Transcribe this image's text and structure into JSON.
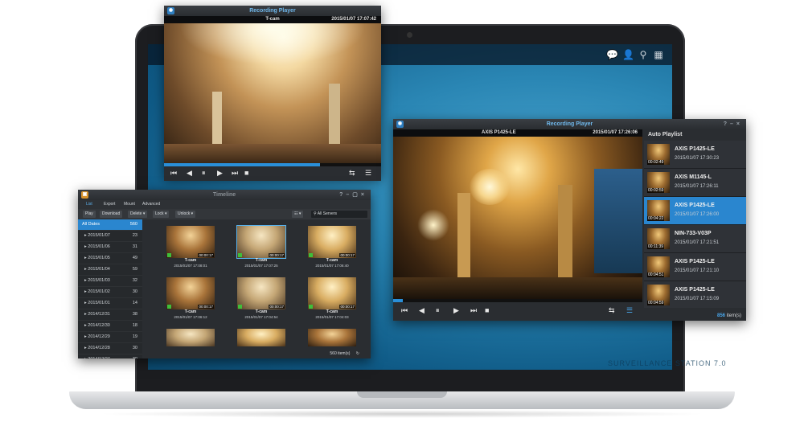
{
  "colors": {
    "accent": "#2a86cf",
    "desktop_blue": "#2a86b4",
    "window_bg": "#2a2d31"
  },
  "desktop": {
    "icons": [
      "chat-icon",
      "user-icon",
      "search-icon",
      "grid-icon"
    ],
    "watermark": "SURVEILLANCE STATION 7.0"
  },
  "player_small": {
    "title": "Recording Player",
    "camera": "T-cam",
    "timestamp": "2015/01/07 17:07:42",
    "progress": 0.72
  },
  "player_large": {
    "title": "Recording Player",
    "camera": "AXIS P1425-LE",
    "timestamp": "2015/01/07 17:26:06",
    "progress": 0.04,
    "playlist_title": "Auto Playlist",
    "items": [
      {
        "name": "AXIS P1425-LE",
        "time": "2015/01/07 17:30:23",
        "duration": "00:02:49",
        "selected": false
      },
      {
        "name": "AXIS M1145-L",
        "time": "2015/01/07 17:26:11",
        "duration": "00:02:59",
        "selected": false
      },
      {
        "name": "AXIS P1425-LE",
        "time": "2015/01/07 17:26:00",
        "duration": "00:04:22",
        "selected": true
      },
      {
        "name": "NIN-733-V03P",
        "time": "2015/01/07 17:21:51",
        "duration": "00:11:39",
        "selected": false
      },
      {
        "name": "AXIS P1425-LE",
        "time": "2015/01/07 17:21:10",
        "duration": "00:04:51",
        "selected": false
      },
      {
        "name": "AXIS P1425-LE",
        "time": "2015/01/07 17:15:09",
        "duration": "00:04:59",
        "selected": false
      }
    ],
    "count_value": "856",
    "count_label": " item(s)"
  },
  "timeline": {
    "title": "Timeline",
    "tabs": [
      "List",
      "Export",
      "Mount",
      "Advanced"
    ],
    "buttons": [
      "Play",
      "Download",
      "Delete ▾",
      "Lock ▾",
      "Unlock ▾"
    ],
    "search_placeholder": "All Servers",
    "dates": [
      {
        "label": "All Dates",
        "count": "560"
      },
      {
        "label": "2015/01/07",
        "count": "23"
      },
      {
        "label": "2015/01/06",
        "count": "31"
      },
      {
        "label": "2015/01/05",
        "count": "49"
      },
      {
        "label": "2015/01/04",
        "count": "59"
      },
      {
        "label": "2015/01/03",
        "count": "32"
      },
      {
        "label": "2015/01/02",
        "count": "30"
      },
      {
        "label": "2015/01/01",
        "count": "14"
      },
      {
        "label": "2014/12/31",
        "count": "38"
      },
      {
        "label": "2014/12/30",
        "count": "18"
      },
      {
        "label": "2014/12/29",
        "count": "19"
      },
      {
        "label": "2014/12/28",
        "count": "30"
      },
      {
        "label": "2014/12/27",
        "count": "30"
      }
    ],
    "recordings": [
      {
        "camera": "T-cam",
        "timestamp": "2015/01/07 17:08:01",
        "duration": "00:00:17",
        "selected": false
      },
      {
        "camera": "T-cam",
        "timestamp": "2015/01/07 17:07:25",
        "duration": "00:00:17",
        "selected": true
      },
      {
        "camera": "T-cam",
        "timestamp": "2015/01/07 17:06:40",
        "duration": "00:00:17",
        "selected": false
      },
      {
        "camera": "T-cam",
        "timestamp": "2015/01/07 17:06:12",
        "duration": "00:00:17",
        "selected": false
      },
      {
        "camera": "T-cam",
        "timestamp": "2015/01/07 17:04:54",
        "duration": "00:00:17",
        "selected": false
      },
      {
        "camera": "T-cam",
        "timestamp": "2015/01/07 17:04:03",
        "duration": "00:00:17",
        "selected": false
      }
    ],
    "count": "560 item(s)"
  }
}
